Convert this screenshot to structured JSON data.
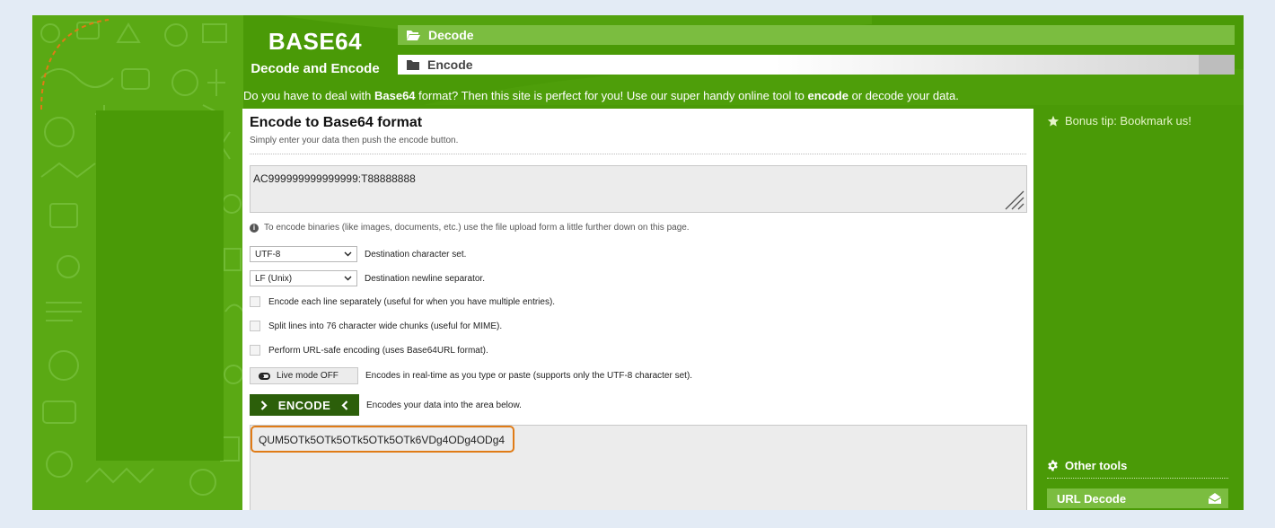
{
  "logo": {
    "title": "BASE64",
    "subtitle": "Decode and Encode"
  },
  "nav": {
    "decode": "Decode",
    "encode": "Encode"
  },
  "intro": {
    "p1": "Do you have to deal with ",
    "b1": "Base64",
    "p2": " format? Then this site is perfect for you! Use our super handy online tool to ",
    "b2": "encode",
    "p3": " or decode your data."
  },
  "main": {
    "title": "Encode to Base64 format",
    "subtitle": "Simply enter your data then push the encode button.",
    "input_value": "AC999999999999999:T88888888",
    "note": "To encode binaries (like images, documents, etc.) use the file upload form a little further down on this page.",
    "charset_value": "UTF-8",
    "charset_label": "Destination character set.",
    "newline_value": "LF (Unix)",
    "newline_label": "Destination newline separator.",
    "opt_each_line": "Encode each line separately (useful for when you have multiple entries).",
    "opt_split": "Split lines into 76 character wide chunks (useful for MIME).",
    "opt_urlsafe": "Perform URL-safe encoding (uses Base64URL format).",
    "live_label": "Live mode OFF",
    "live_desc": "Encodes in real-time as you type or paste (supports only the UTF-8 character set).",
    "encode_label": "ENCODE",
    "encode_desc": "Encodes your data into the area below.",
    "output_value": "QUM5OTk5OTk5OTk5OTk5OTk6VDg4ODg4ODg4"
  },
  "sidebar": {
    "bonus": "Bonus tip: Bookmark us!",
    "other_tools": "Other tools",
    "url_decode": "URL Decode"
  },
  "colors": {
    "green": "#4a9a07",
    "light_green": "#7bbd40",
    "dark_green": "#2c5f0a",
    "highlight": "#e07b16"
  }
}
